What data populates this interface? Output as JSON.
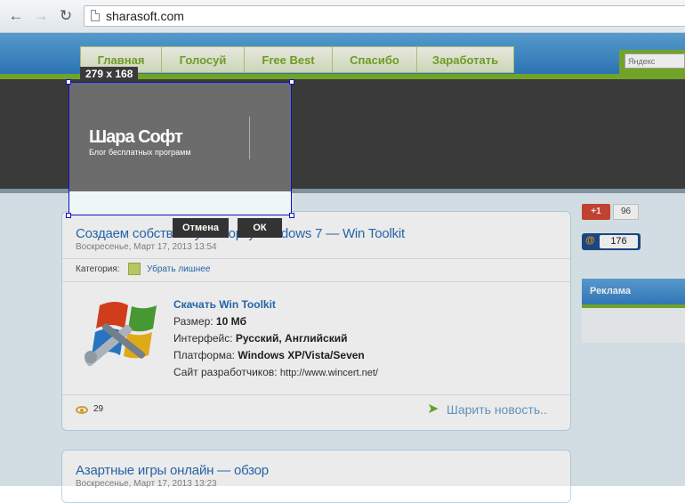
{
  "browser": {
    "back_icon": "back-arrow-icon",
    "forward_icon": "forward-arrow-icon",
    "reload_icon": "reload-icon",
    "url": "sharasoft.com"
  },
  "site": {
    "menu": [
      "Главная",
      "Голосуй",
      "Free Best",
      "Спасибо",
      "Заработать"
    ],
    "search_placeholder": "Яндекс",
    "name": "Шара Софт",
    "tagline": "Блог бесплатных программ"
  },
  "capture": {
    "size_label": "279 x 168",
    "cancel_label": "Отмена",
    "ok_label": "ОК"
  },
  "post": {
    "title": "Создаем собственную сборку Windows 7 — Win Toolkit",
    "date": "Воскресенье, Март 17, 2013 13:54",
    "category_label": "Категория:",
    "category": "Убрать лишнее",
    "download_link": "Скачать Win Toolkit",
    "size_label": "Размер:",
    "size_value": "10 Мб",
    "interface_label": "Интерфейс:",
    "interface_value": "Русский, Английский",
    "platform_label": "Платформа:",
    "platform_value": "Windows XP/Vista/Seven",
    "dev_site_label": "Сайт разработчиков:",
    "dev_site_value": "http://www.wincert.net/",
    "views": "29",
    "share_label": "Шарить новость..",
    "logo_icon": "windows-toolkit-logo"
  },
  "post2": {
    "title": "Азартные игры онлайн — обзор",
    "date": "Воскресенье, Март 17, 2013 13:23"
  },
  "sidebar": {
    "gplus_label": "+1",
    "gplus_count": "96",
    "mail_icon": "@",
    "mail_count": "176",
    "ad_title": "Реклама"
  }
}
